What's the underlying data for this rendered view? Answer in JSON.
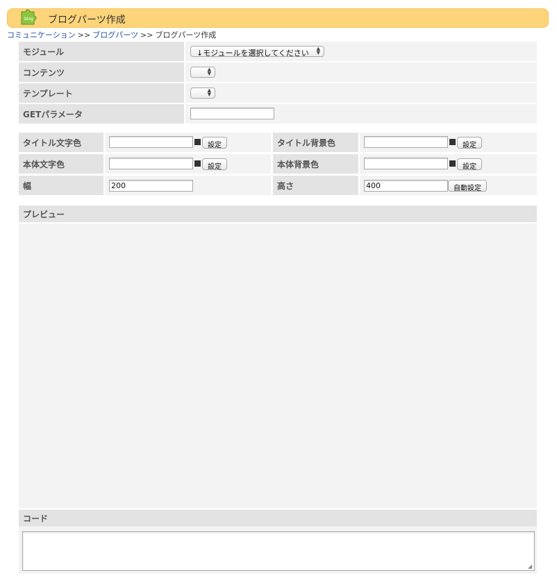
{
  "header": {
    "title": "ブログパーツ作成",
    "icon": "blog-puzzle-icon",
    "icon_text": "blog"
  },
  "breadcrumb": {
    "items": [
      "コミュニケーション",
      "ブログパーツ",
      "ブログパーツ作成"
    ],
    "separator": ">>"
  },
  "form1": {
    "module_label": "モジュール",
    "module_selected": "↓モジュールを選択してください",
    "content_label": "コンテンツ",
    "content_selected": "",
    "template_label": "テンプレート",
    "template_selected": "",
    "get_label": "GETパラメータ",
    "get_value": ""
  },
  "form2": {
    "title_color_label": "タイトル文字色",
    "title_color_value": "",
    "title_bg_label": "タイトル背景色",
    "title_bg_value": "",
    "body_color_label": "本体文字色",
    "body_color_value": "",
    "body_bg_label": "本体背景色",
    "body_bg_value": "",
    "width_label": "幅",
    "width_value": "200",
    "height_label": "高さ",
    "height_value": "400",
    "set_button": "設定",
    "auto_button": "自動設定"
  },
  "preview": {
    "label": "プレビュー"
  },
  "code": {
    "label": "コード",
    "value": ""
  },
  "colors": {
    "header_bg": "#fdd479",
    "label_bg": "#e3e3e3",
    "value_bg": "#f3f3f3",
    "link": "#1f4ea8"
  }
}
